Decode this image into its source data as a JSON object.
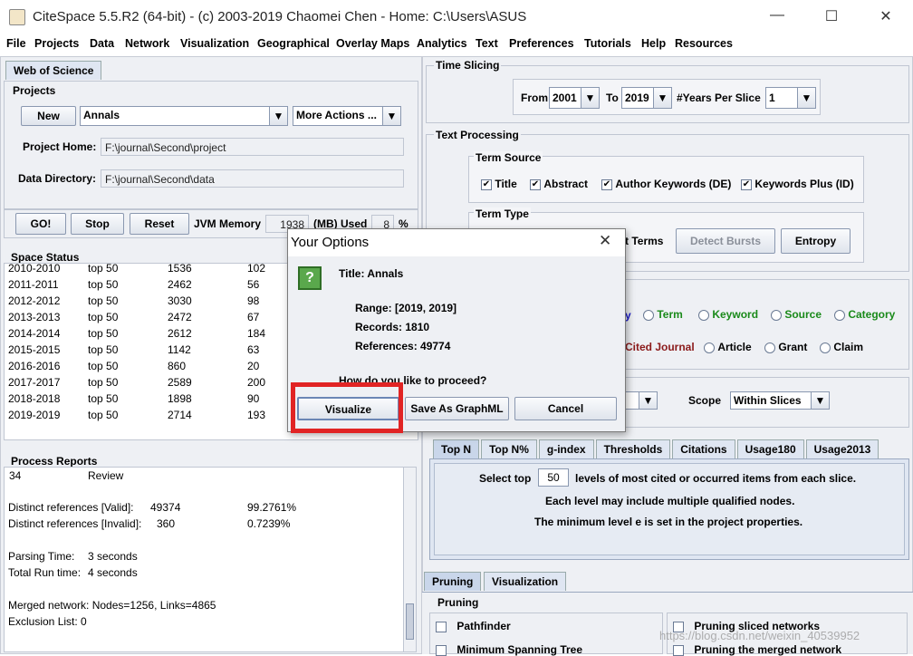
{
  "window": {
    "title": "CiteSpace 5.5.R2 (64-bit) - (c) 2003-2019 Chaomei Chen - Home: C:\\Users\\ASUS"
  },
  "menu": [
    "File",
    "Projects",
    "Data",
    "Network",
    "Visualization",
    "Geographical",
    "Overlay Maps",
    "Analytics",
    "Text",
    "Preferences",
    "Tutorials",
    "Help",
    "Resources"
  ],
  "left": {
    "tab": "Web of Science",
    "projects_label": "Projects",
    "new_label": "New",
    "project_name": "Annals",
    "more_actions": "More Actions ...",
    "home_label": "Project Home:",
    "home_value": "F:\\journal\\Second\\project",
    "data_label": "Data Directory:",
    "data_value": "F:\\journal\\Second\\data",
    "go": "GO!",
    "stop": "Stop",
    "reset": "Reset",
    "jvm_label": "JVM Memory",
    "jvm_value": "1938",
    "mb_used": "(MB) Used",
    "pct_value": "8",
    "pct_sign": "%",
    "space_status": "Space Status",
    "rows": [
      [
        "2010-2010",
        "top 50",
        "1536",
        "102"
      ],
      [
        "2011-2011",
        "top 50",
        "2462",
        "56"
      ],
      [
        "2012-2012",
        "top 50",
        "3030",
        "98"
      ],
      [
        "2013-2013",
        "top 50",
        "2472",
        "67"
      ],
      [
        "2014-2014",
        "top 50",
        "2612",
        "184"
      ],
      [
        "2015-2015",
        "top 50",
        "1142",
        "63"
      ],
      [
        "2016-2016",
        "top 50",
        "860",
        "20"
      ],
      [
        "2017-2017",
        "top 50",
        "2589",
        "200"
      ],
      [
        "2018-2018",
        "top 50",
        "1898",
        "90"
      ],
      [
        "2019-2019",
        "top 50",
        "2714",
        "193"
      ]
    ],
    "process_reports": "Process Reports",
    "report": {
      "r1a": "34",
      "r1b": "Review",
      "r2a": "Distinct references [Valid]:",
      "r2b": "49374",
      "r2c": "99.2761%",
      "r3a": "Distinct references [Invalid]:",
      "r3b": "360",
      "r3c": "0.7239%",
      "r4a": "Parsing Time:",
      "r4b": "3 seconds",
      "r5a": "Total Run time:",
      "r5b": "4 seconds",
      "r6": "Merged network: Nodes=1256, Links=4865",
      "r7": "Exclusion List: 0"
    }
  },
  "right": {
    "time_slicing": "Time Slicing",
    "from_label": "From",
    "from_value": "2001",
    "to_label": "To",
    "to_value": "2019",
    "years_label": "#Years Per Slice",
    "years_value": "1",
    "text_processing": "Text Processing",
    "term_source": "Term Source",
    "sources": [
      "Title",
      "Abstract",
      "Author Keywords (DE)",
      "Keywords Plus (ID)"
    ],
    "term_type": "Term Type",
    "noun_terms": "t Terms",
    "detect_bursts": "Detect Bursts",
    "entropy": "Entropy",
    "node_types_row1_partial": "y",
    "node_types_row1": [
      "Term",
      "Keyword",
      "Source",
      "Category"
    ],
    "cited_journal": "Cited Journal",
    "node_types_row2": [
      "Article",
      "Grant",
      "Claim"
    ],
    "scope_label": "Scope",
    "scope_value": "Within Slices",
    "sel_tabs": [
      "Top N",
      "Top N%",
      "g-index",
      "Thresholds",
      "Citations",
      "Usage180",
      "Usage2013"
    ],
    "select_top": "Select top",
    "select_top_value": "50",
    "select_top_tail": "levels of most cited or occurred items from each slice.",
    "info1": "Each level may include multiple qualified nodes.",
    "info2": "The minimum level e is set in the project properties.",
    "prune_tabs": [
      "Pruning",
      "Visualization"
    ],
    "pruning_label": "Pruning",
    "prune_left": [
      "Pathfinder",
      "Minimum Spanning Tree"
    ],
    "prune_right": [
      "Pruning sliced networks",
      "Pruning the merged network"
    ],
    "watermark": "https://blog.csdn.net/weixin_40539952"
  },
  "dialog": {
    "title": "Your Options",
    "icon_text": "?",
    "title_line": "Title: Annals",
    "range": "Range: [2019, 2019]",
    "records": "Records: 1810",
    "references": "References: 49774",
    "question": "How do you like to proceed?",
    "visualize": "Visualize",
    "save": "Save As GraphML",
    "cancel": "Cancel",
    "close": "✕"
  },
  "colors": {
    "highlight": "#e12424",
    "green_text": "#1a8a1a",
    "darkred_text": "#8b1a1a",
    "blue_text": "#1a1acc"
  }
}
